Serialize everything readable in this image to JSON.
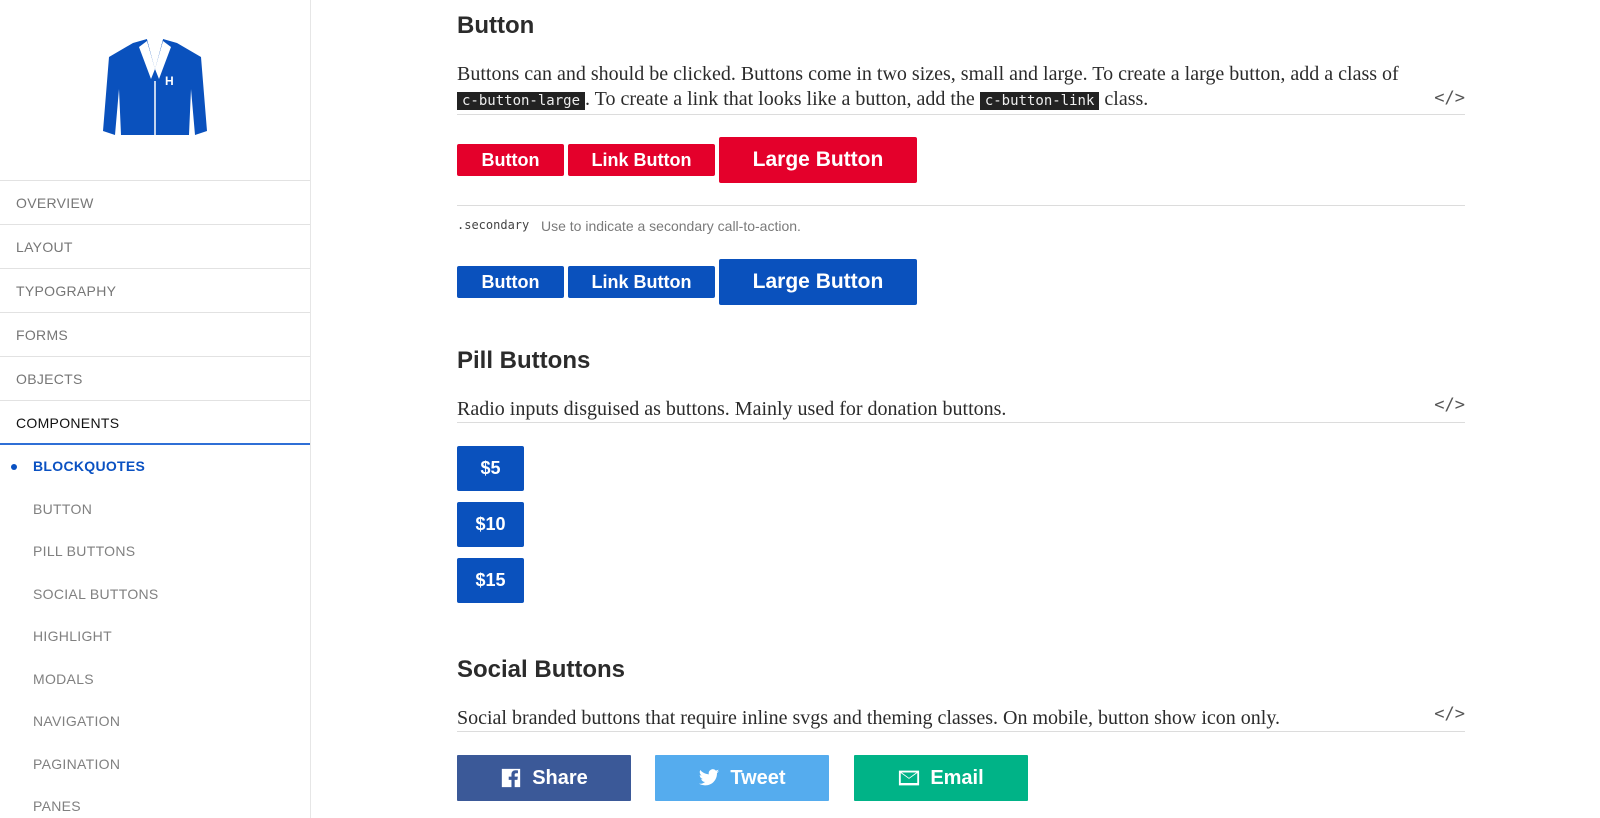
{
  "sidebar": {
    "nav": [
      "OVERVIEW",
      "LAYOUT",
      "TYPOGRAPHY",
      "FORMS",
      "OBJECTS",
      "COMPONENTS"
    ],
    "active": "COMPONENTS",
    "sub": [
      "BLOCKQUOTES",
      "BUTTON",
      "PILL BUTTONS",
      "SOCIAL BUTTONS",
      "HIGHLIGHT",
      "MODALS",
      "NAVIGATION",
      "PAGINATION",
      "PANES"
    ],
    "current_sub": "BLOCKQUOTES"
  },
  "button_section": {
    "title": "Button",
    "desc_part1": "Buttons can and should be clicked. Buttons come in two sizes, small and large. To create a large button, add a class of ",
    "code1": "c-button-large",
    "desc_part2": ". To create a link that looks like a button, add the ",
    "code2": "c-button-link",
    "desc_part3": " class.",
    "code_toggle": "</>",
    "buttons": [
      "Button",
      "Link Button",
      "Large Button"
    ],
    "modifier_code": ".secondary",
    "modifier_desc": "Use to indicate a secondary call-to-action.",
    "secondary_buttons": [
      "Button",
      "Link Button",
      "Large Button"
    ]
  },
  "pill_section": {
    "title": "Pill Buttons",
    "desc": "Radio inputs disguised as buttons. Mainly used for donation buttons.",
    "code_toggle": "</>",
    "pills": [
      "$5",
      "$10",
      "$15"
    ]
  },
  "social_section": {
    "title": "Social Buttons",
    "desc": "Social branded buttons that require inline svgs and theming classes. On mobile, button show icon only.",
    "code_toggle": "</>",
    "buttons": [
      {
        "label": "Share",
        "icon": "facebook-icon",
        "color": "#3b5998"
      },
      {
        "label": "Tweet",
        "icon": "twitter-icon",
        "color": "#55acee"
      },
      {
        "label": "Email",
        "icon": "email-icon",
        "color": "#00b387"
      }
    ]
  },
  "colors": {
    "primary_red": "#e4002b",
    "secondary_blue": "#0a51bd",
    "nav_active_underline": "#2f6fd6"
  }
}
